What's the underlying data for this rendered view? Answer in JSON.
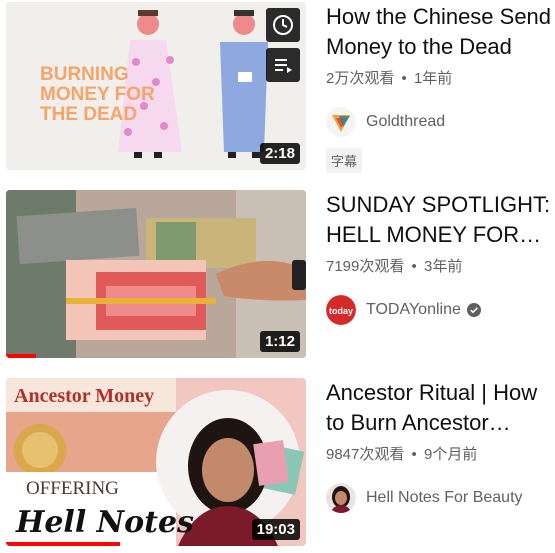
{
  "videos": [
    {
      "title": "How the Chinese Send Money to the Dead",
      "views": "2万次观看",
      "age": "1年前",
      "channel": "Goldthread",
      "badge": "字幕",
      "duration": "2:18",
      "thumb_text": [
        "BURNING",
        "MONEY FOR",
        "THE DEAD"
      ],
      "hover_icons": [
        "clock-icon",
        "add-to-queue-icon"
      ],
      "watch_progress": 0
    },
    {
      "title": "SUNDAY SPOTLIGHT: HELL MONEY FOR…",
      "views": "7199次观看",
      "age": "3年前",
      "channel": "TODAYonline",
      "channel_verified": true,
      "avatar_text": "today",
      "duration": "1:12",
      "watch_progress": 0.1
    },
    {
      "title": "Ancestor Ritual | How to Burn Ancestor…",
      "views": "9847次观看",
      "age": "9个月前",
      "channel": "Hell Notes For Beauty",
      "duration": "19:03",
      "thumb_text": [
        "Ancestor Money",
        "OFFERING",
        "Hell Notes"
      ],
      "watch_progress": 0.38
    }
  ],
  "separator": "•",
  "colors": {
    "progress": "#ff0000",
    "meta": "#606060",
    "title": "#0f0f0f"
  }
}
